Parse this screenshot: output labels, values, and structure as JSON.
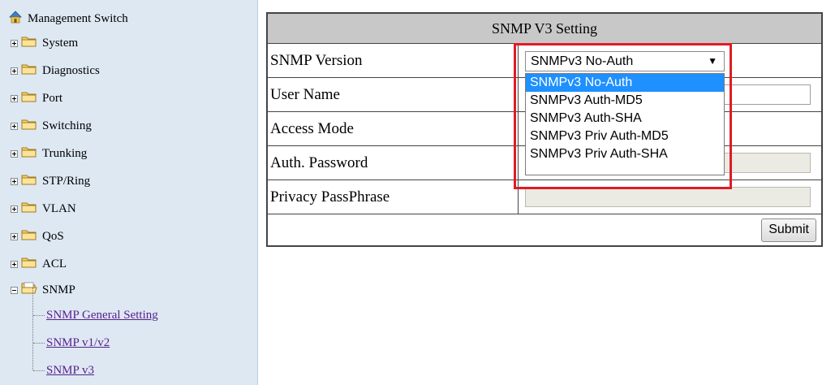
{
  "sidebar": {
    "root_label": "Management Switch",
    "items": [
      {
        "label": "System",
        "expanded": false
      },
      {
        "label": "Diagnostics",
        "expanded": false
      },
      {
        "label": "Port",
        "expanded": false
      },
      {
        "label": "Switching",
        "expanded": false
      },
      {
        "label": "Trunking",
        "expanded": false
      },
      {
        "label": "STP/Ring",
        "expanded": false
      },
      {
        "label": "VLAN",
        "expanded": false
      },
      {
        "label": "QoS",
        "expanded": false
      },
      {
        "label": "ACL",
        "expanded": false
      },
      {
        "label": "SNMP",
        "expanded": true
      }
    ],
    "snmp_children": [
      "SNMP General Setting",
      "SNMP v1/v2",
      "SNMP v3"
    ]
  },
  "form": {
    "title": "SNMP V3 Setting",
    "snmp_version_label": "SNMP Version",
    "user_name_label": "User Name",
    "access_mode_label": "Access Mode",
    "auth_password_label": "Auth. Password",
    "privacy_passphrase_label": "Privacy PassPhrase",
    "submit_label": "Submit"
  },
  "snmp_version_select": {
    "value": "SNMPv3 No-Auth",
    "arrow": "▼",
    "options": [
      "SNMPv3 No-Auth",
      "SNMPv3 Auth-MD5",
      "SNMPv3 Auth-SHA",
      "SNMPv3 Priv Auth-MD5",
      "SNMPv3 Priv Auth-SHA"
    ],
    "selected_index": 0
  },
  "colors": {
    "sidebar_bg": "#dde8f3",
    "header_bg": "#c8c8c8",
    "highlight": "#e01b24",
    "option_selected": "#1e90ff",
    "link": "#5a1e8c"
  }
}
